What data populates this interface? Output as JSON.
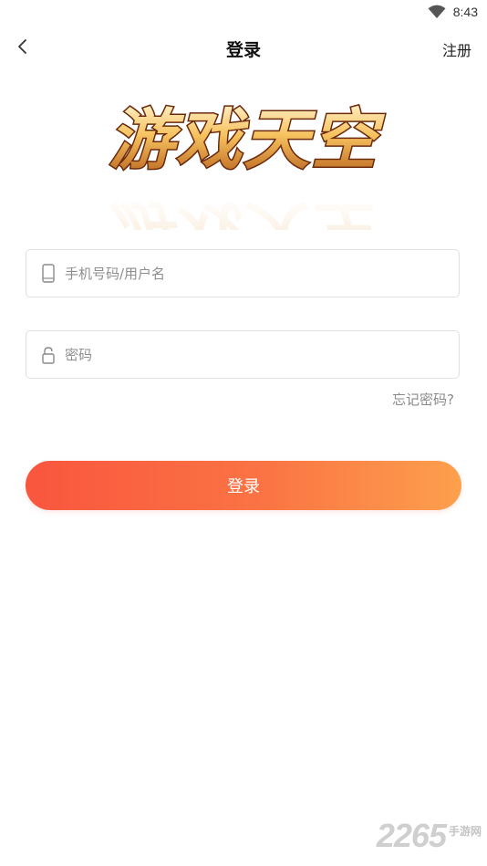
{
  "status_bar": {
    "time": "8:43",
    "icons": [
      "wifi-icon"
    ]
  },
  "header": {
    "title": "登录",
    "back_icon": "chevron-left-icon",
    "register_label": "注册"
  },
  "logo": {
    "text": "游戏天空"
  },
  "form": {
    "username": {
      "placeholder": "手机号码/用户名",
      "value": "",
      "icon": "phone-icon"
    },
    "password": {
      "placeholder": "密码",
      "value": "",
      "icon": "lock-icon"
    },
    "forgot_label": "忘记密码?",
    "submit_label": "登录"
  },
  "watermark": {
    "number": "2265",
    "text": "手游网"
  },
  "colors": {
    "button_start": "#f9563e",
    "button_end": "#fda04d",
    "placeholder": "#8e8e8e",
    "border": "#e0e0e0"
  }
}
